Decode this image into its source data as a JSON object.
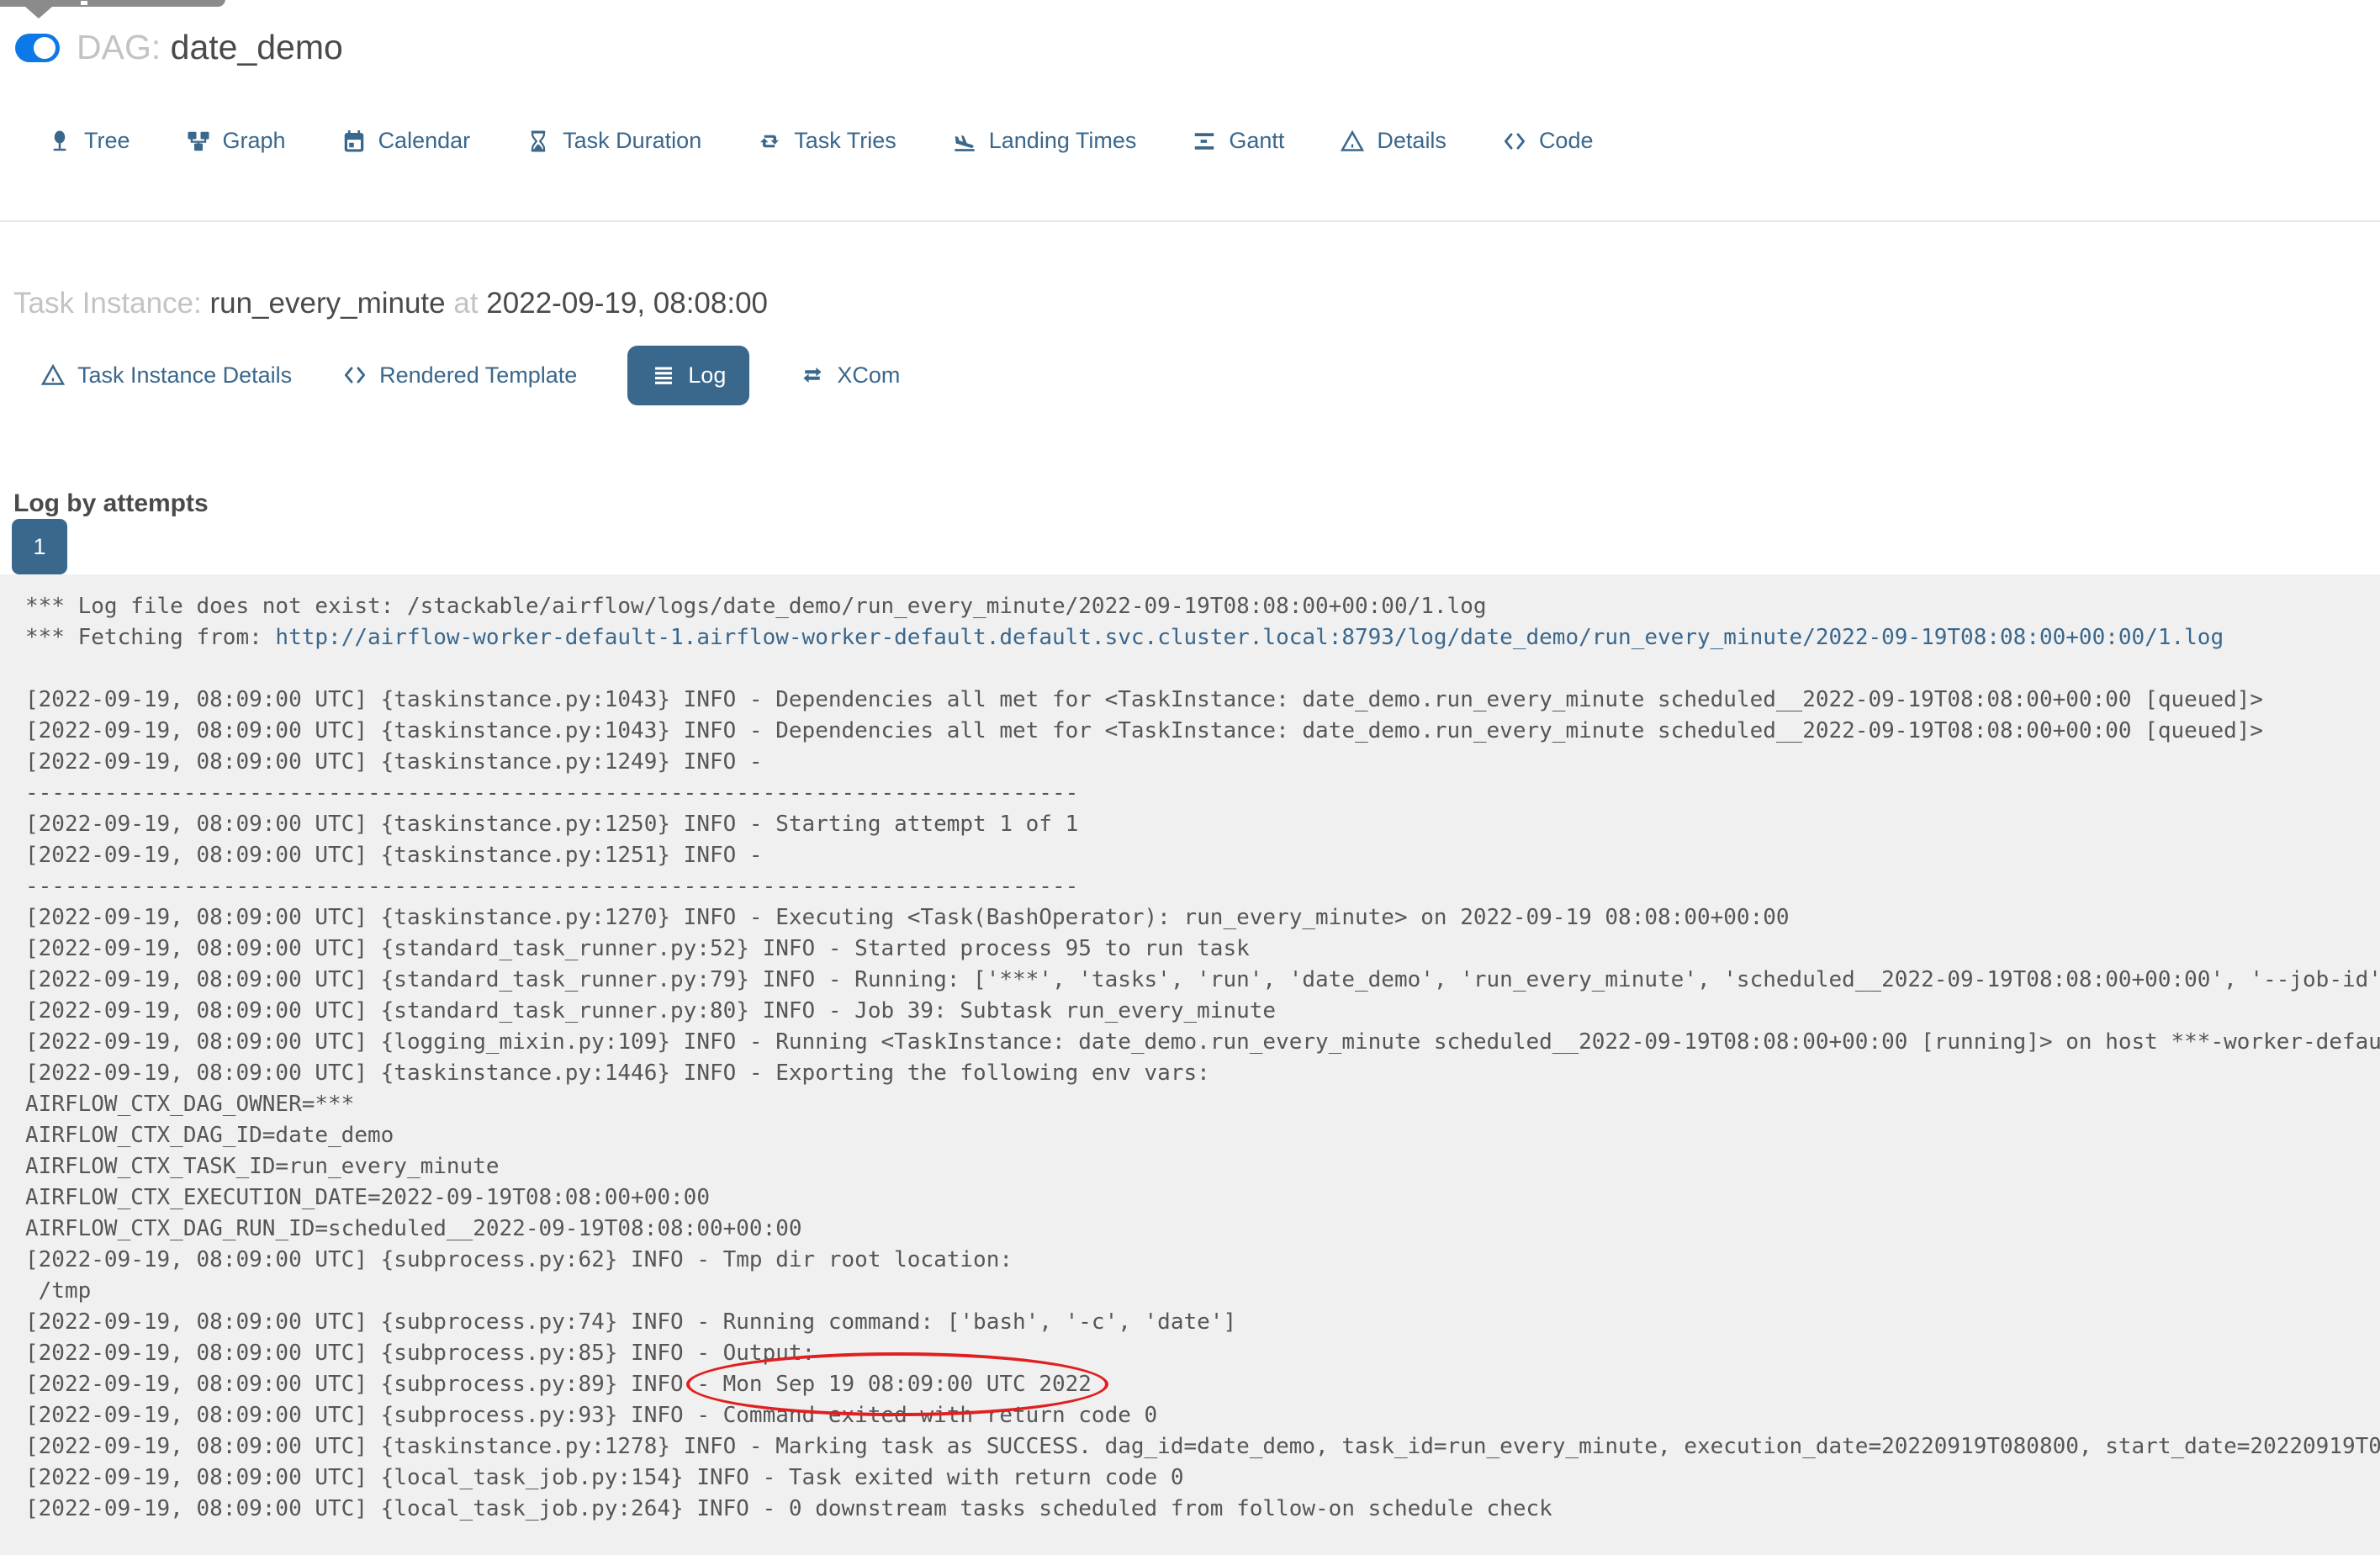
{
  "colors": {
    "accent": "#3a678c",
    "toggle_on": "#0d78e7",
    "log_background": "#f0f0f0",
    "annotation": "#e02020"
  },
  "header": {
    "dag_label": "DAG:",
    "dag_name": "date_demo",
    "toggle_state": "on"
  },
  "nav_tabs": [
    {
      "label": "Tree",
      "icon": "tree-icon"
    },
    {
      "label": "Graph",
      "icon": "graph-icon"
    },
    {
      "label": "Calendar",
      "icon": "calendar-icon"
    },
    {
      "label": "Task Duration",
      "icon": "hourglass-icon"
    },
    {
      "label": "Task Tries",
      "icon": "repeat-icon"
    },
    {
      "label": "Landing Times",
      "icon": "plane-landing-icon"
    },
    {
      "label": "Gantt",
      "icon": "gantt-icon"
    },
    {
      "label": "Details",
      "icon": "warning-triangle-icon"
    },
    {
      "label": "Code",
      "icon": "code-icon"
    }
  ],
  "task_instance": {
    "label": "Task Instance:",
    "name": "run_every_minute",
    "at_label": "at",
    "datetime": "2022-09-19, 08:08:00"
  },
  "sub_tabs": [
    {
      "label": "Task Instance Details",
      "icon": "warning-triangle-icon",
      "active": false
    },
    {
      "label": "Rendered Template",
      "icon": "code-icon",
      "active": false
    },
    {
      "label": "Log",
      "icon": "list-icon",
      "active": true
    },
    {
      "label": "XCom",
      "icon": "exchange-icon",
      "active": false
    }
  ],
  "log_section": {
    "heading": "Log by attempts",
    "attempt_number": "1",
    "annotation": {
      "shape": "ellipse",
      "color": "#e02020",
      "around_text": "Mon Sep 19 08:09:00 UTC 2022"
    },
    "lines": [
      "*** Log file does not exist: /stackable/airflow/logs/date_demo/run_every_minute/2022-09-19T08:08:00+00:00/1.log",
      {
        "prefix": "*** Fetching from: ",
        "link": "http://airflow-worker-default-1.airflow-worker-default.default.svc.cluster.local:8793/log/date_demo/run_every_minute/2022-09-19T08:08:00+00:00/1.log"
      },
      "",
      "[2022-09-19, 08:09:00 UTC] {taskinstance.py:1043} INFO - Dependencies all met for <TaskInstance: date_demo.run_every_minute scheduled__2022-09-19T08:08:00+00:00 [queued]>",
      "[2022-09-19, 08:09:00 UTC] {taskinstance.py:1043} INFO - Dependencies all met for <TaskInstance: date_demo.run_every_minute scheduled__2022-09-19T08:08:00+00:00 [queued]>",
      "[2022-09-19, 08:09:00 UTC] {taskinstance.py:1249} INFO - ",
      "--------------------------------------------------------------------------------",
      "[2022-09-19, 08:09:00 UTC] {taskinstance.py:1250} INFO - Starting attempt 1 of 1",
      "[2022-09-19, 08:09:00 UTC] {taskinstance.py:1251} INFO - ",
      "--------------------------------------------------------------------------------",
      "[2022-09-19, 08:09:00 UTC] {taskinstance.py:1270} INFO - Executing <Task(BashOperator): run_every_minute> on 2022-09-19 08:08:00+00:00",
      "[2022-09-19, 08:09:00 UTC] {standard_task_runner.py:52} INFO - Started process 95 to run task",
      "[2022-09-19, 08:09:00 UTC] {standard_task_runner.py:79} INFO - Running: ['***', 'tasks', 'run', 'date_demo', 'run_every_minute', 'scheduled__2022-09-19T08:08:00+00:00', '--job-id'",
      "[2022-09-19, 08:09:00 UTC] {standard_task_runner.py:80} INFO - Job 39: Subtask run_every_minute",
      "[2022-09-19, 08:09:00 UTC] {logging_mixin.py:109} INFO - Running <TaskInstance: date_demo.run_every_minute scheduled__2022-09-19T08:08:00+00:00 [running]> on host ***-worker-defau",
      "[2022-09-19, 08:09:00 UTC] {taskinstance.py:1446} INFO - Exporting the following env vars:",
      "AIRFLOW_CTX_DAG_OWNER=***",
      "AIRFLOW_CTX_DAG_ID=date_demo",
      "AIRFLOW_CTX_TASK_ID=run_every_minute",
      "AIRFLOW_CTX_EXECUTION_DATE=2022-09-19T08:08:00+00:00",
      "AIRFLOW_CTX_DAG_RUN_ID=scheduled__2022-09-19T08:08:00+00:00",
      "[2022-09-19, 08:09:00 UTC] {subprocess.py:62} INFO - Tmp dir root location:",
      " /tmp",
      "[2022-09-19, 08:09:00 UTC] {subprocess.py:74} INFO - Running command: ['bash', '-c', 'date']",
      "[2022-09-19, 08:09:00 UTC] {subprocess.py:85} INFO - Output:",
      "[2022-09-19, 08:09:00 UTC] {subprocess.py:89} INFO - Mon Sep 19 08:09:00 UTC 2022",
      "[2022-09-19, 08:09:00 UTC] {subprocess.py:93} INFO - Command exited with return code 0",
      "[2022-09-19, 08:09:00 UTC] {taskinstance.py:1278} INFO - Marking task as SUCCESS. dag_id=date_demo, task_id=run_every_minute, execution_date=20220919T080800, start_date=20220919T0",
      "[2022-09-19, 08:09:00 UTC] {local_task_job.py:154} INFO - Task exited with return code 0",
      "[2022-09-19, 08:09:00 UTC] {local_task_job.py:264} INFO - 0 downstream tasks scheduled from follow-on schedule check"
    ]
  }
}
